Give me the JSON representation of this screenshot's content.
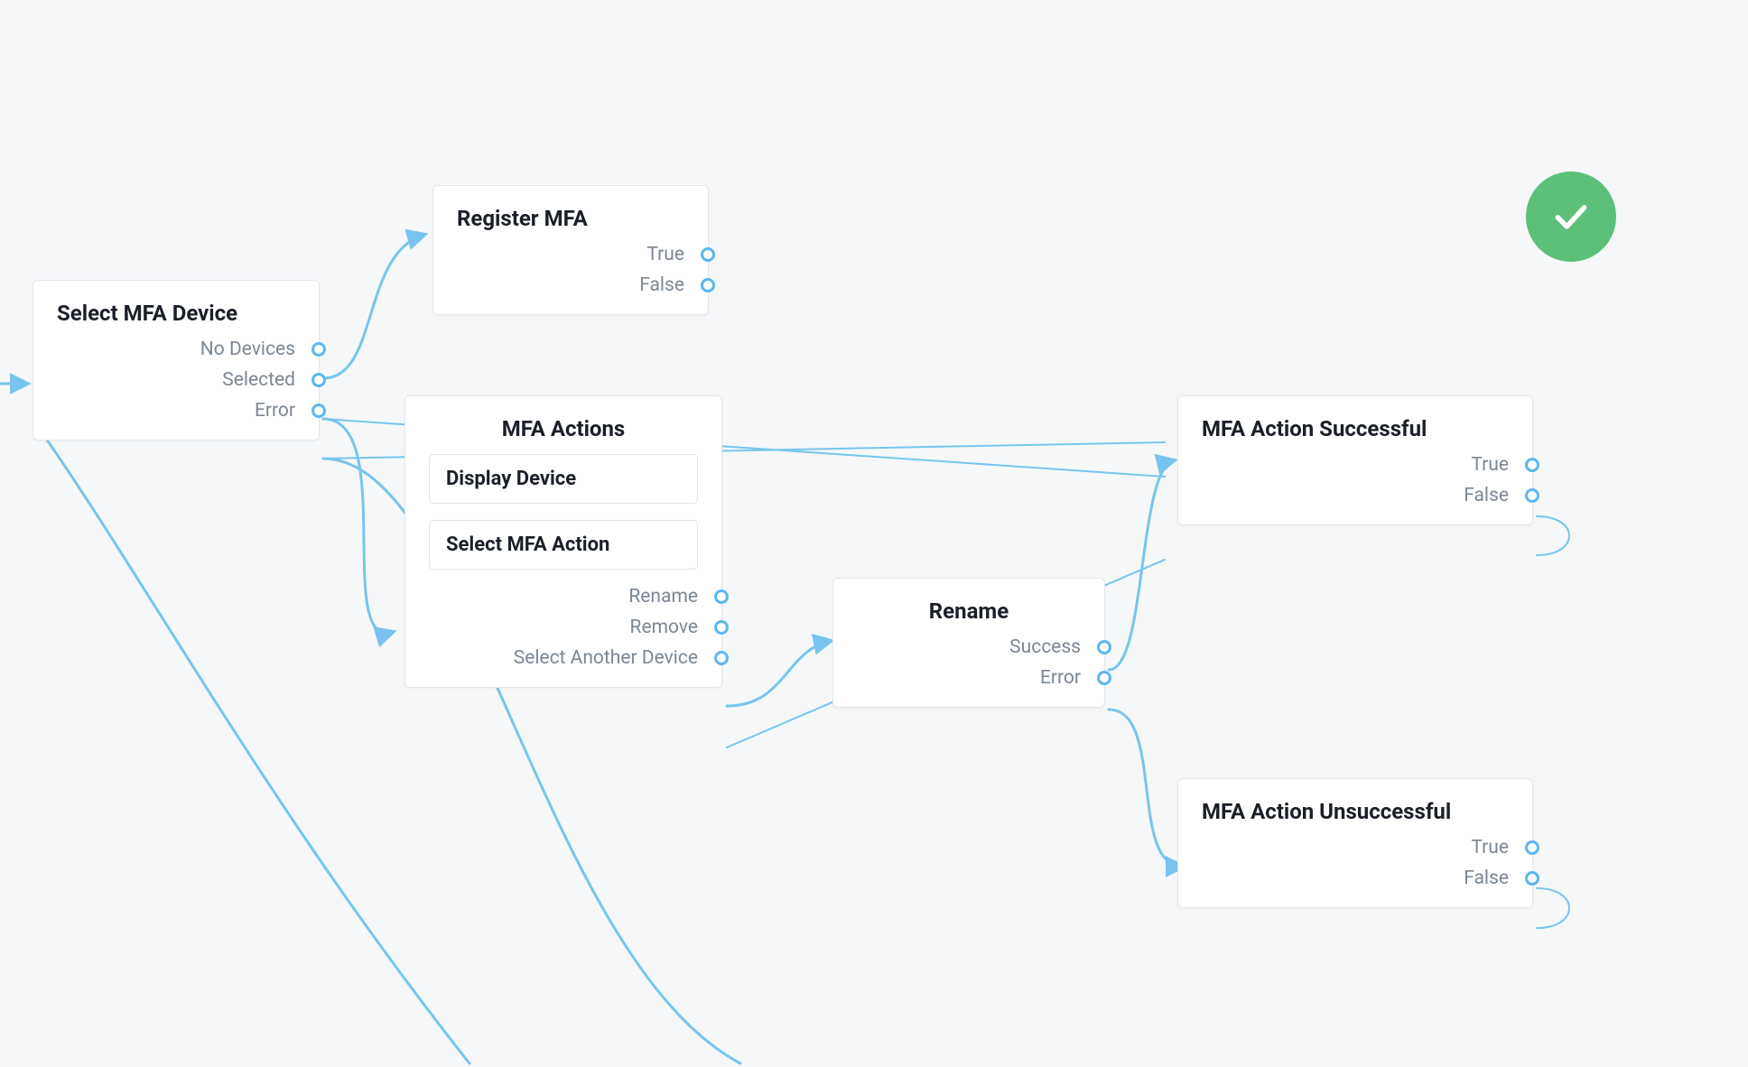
{
  "colors": {
    "edge": "#78c4ee",
    "port": "#5eb6f0",
    "bg": "#f5f7f9",
    "node_bg": "#ffffff",
    "node_border": "#e3e7eb",
    "title": "#1a1f28",
    "label": "#7b8794",
    "success": "#5cc078"
  },
  "badge": {
    "type": "success-check"
  },
  "nodes": {
    "select_device": {
      "title": "Select MFA Device",
      "outputs": [
        "No Devices",
        "Selected",
        "Error"
      ]
    },
    "register_mfa": {
      "title": "Register MFA",
      "outputs": [
        "True",
        "False"
      ]
    },
    "mfa_actions": {
      "title": "MFA Actions",
      "sub": [
        "Display Device",
        "Select MFA Action"
      ],
      "outputs": [
        "Rename",
        "Remove",
        "Select Another Device"
      ]
    },
    "rename": {
      "title": "Rename",
      "outputs": [
        "Success",
        "Error"
      ]
    },
    "action_success": {
      "title": "MFA Action Successful",
      "outputs": [
        "True",
        "False"
      ]
    },
    "action_fail": {
      "title": "MFA Action Unsuccessful",
      "outputs": [
        "True",
        "False"
      ]
    }
  }
}
